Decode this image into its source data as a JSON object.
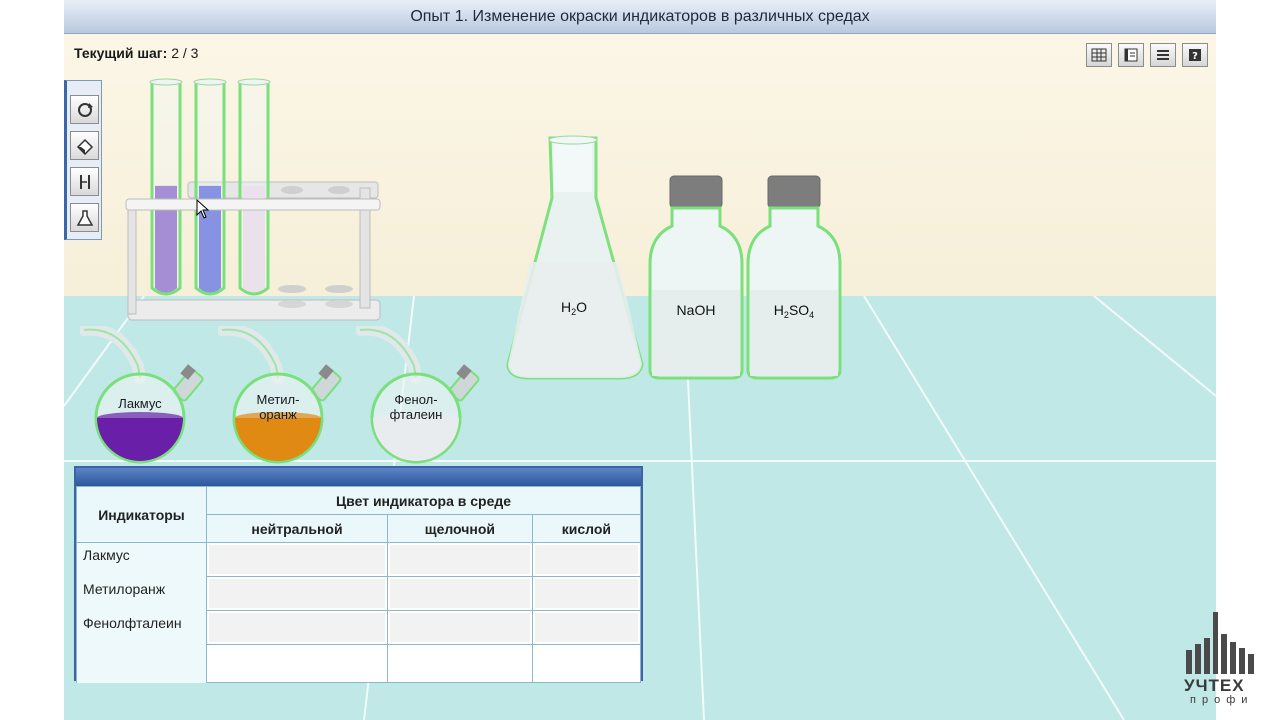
{
  "title": "Опыт 1. Изменение окраски индикаторов в различных средах",
  "step": {
    "label": "Текущий шаг:",
    "value": "2 / 3"
  },
  "toolbar_right": [
    {
      "icon": "table-icon"
    },
    {
      "icon": "journal-icon"
    },
    {
      "icon": "list-icon"
    },
    {
      "icon": "help-icon"
    }
  ],
  "left_tools": [
    {
      "icon": "reset-icon"
    },
    {
      "icon": "eraser-icon"
    },
    {
      "icon": "tube-tool-icon"
    },
    {
      "icon": "flask-tool-icon"
    }
  ],
  "tubes": [
    {
      "color": "#7e57c2",
      "fill": 0.75
    },
    {
      "color": "#4f5fd8",
      "fill": 0.75
    },
    {
      "color": "#e8d6e6",
      "fill": 0.75
    }
  ],
  "vessels": {
    "water": {
      "label_main": "H",
      "label_sub": "2",
      "label_tail": "O"
    },
    "naoh": {
      "label": "NaOH"
    },
    "h2so4": {
      "label_main": "H",
      "label_sub": "2",
      "label_mid": "SO",
      "label_sub2": "4"
    }
  },
  "indicator_flasks": [
    {
      "line1": "Лакмус",
      "line2": "",
      "color": "#6a1fa8"
    },
    {
      "line1": "Метил-",
      "line2": "оранж",
      "color": "#e08a14"
    },
    {
      "line1": "Фенол-",
      "line2": "фталеин",
      "color": "#e8ecef"
    }
  ],
  "table": {
    "col_indicators": "Индикаторы",
    "col_group": "Цвет индикатора в среде",
    "sub_cols": [
      "нейтральной",
      "щелочной",
      "кислой"
    ],
    "rows": [
      "Лакмус",
      "Метилоранж",
      "Фенолфталеин"
    ]
  },
  "logo": {
    "text": "УЧТЕХ",
    "sub": "профи"
  }
}
